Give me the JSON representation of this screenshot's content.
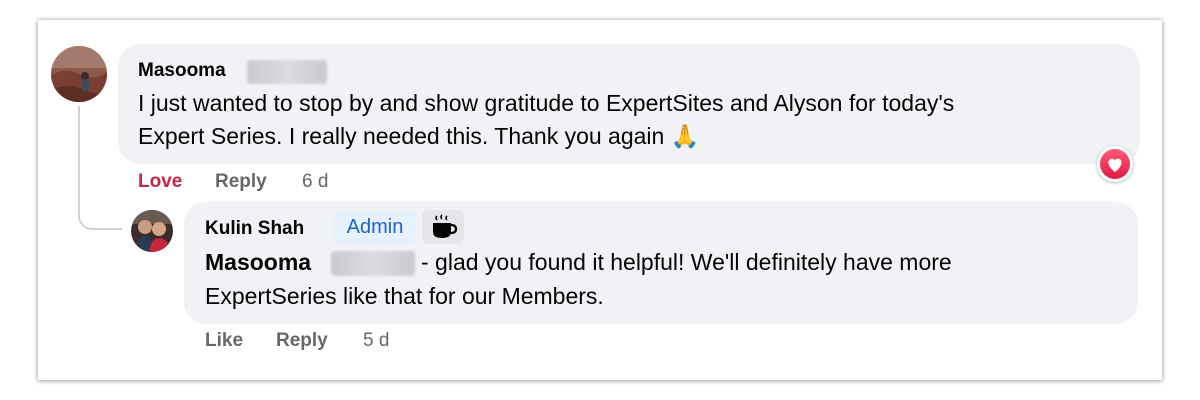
{
  "comment": {
    "author": "Masooma",
    "text_line1": "I just wanted to stop by and show gratitude to ExpertSites and Alyson for today's",
    "text_line2": "Expert Series. I really needed this. Thank you again 🙏",
    "actions": {
      "love": "Love",
      "reply": "Reply",
      "time": "6 d"
    },
    "reaction": "heart-icon"
  },
  "reply": {
    "author": "Kulin Shah",
    "badge": "Admin",
    "badge_icon": "coffee-cup-icon",
    "mention": "Masooma",
    "text_line1": "- glad you found it helpful! We'll definitely have more",
    "text_line2": "ExpertSeries like that for our Members.",
    "actions": {
      "like": "Like",
      "reply": "Reply",
      "time": "5 d"
    }
  },
  "colors": {
    "bubble": "#f0f2f5",
    "love": "#c12a47",
    "admin_text": "#1d64c4",
    "admin_bg": "#e7f0fd",
    "muted": "#65676b"
  }
}
